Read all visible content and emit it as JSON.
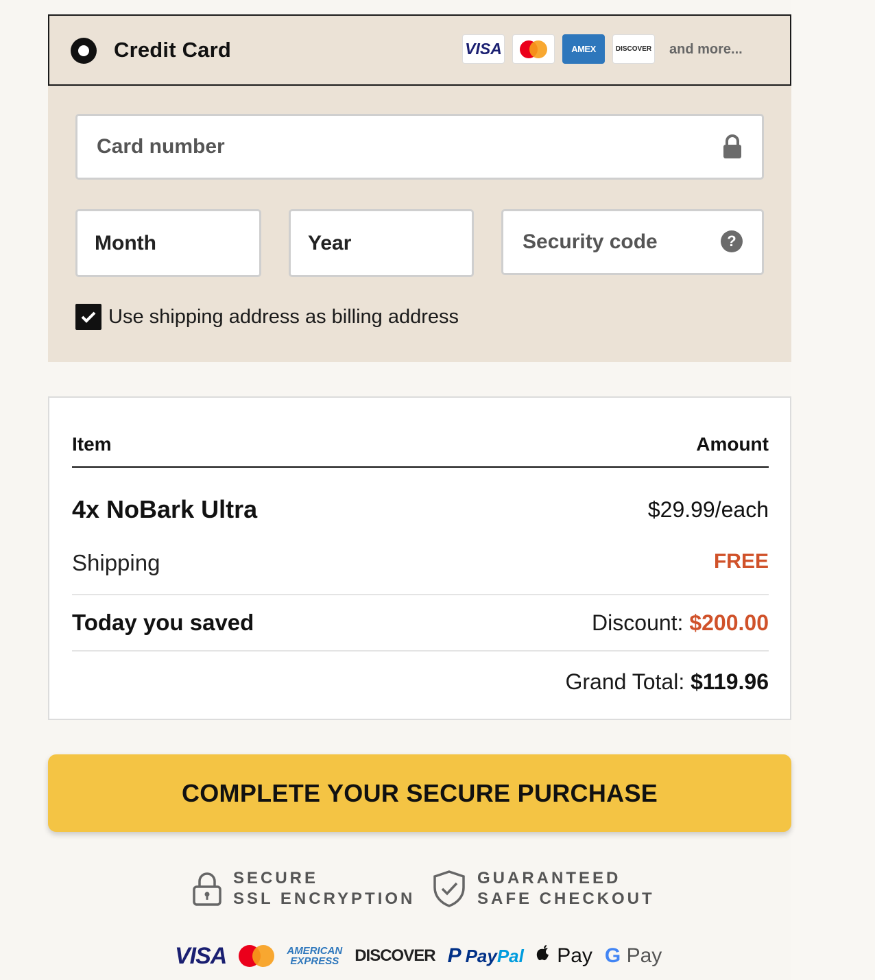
{
  "payment_method": {
    "title": "Credit Card",
    "selected": true,
    "card_logos": [
      "VISA",
      "mastercard",
      "AMEX",
      "DISCOVER"
    ],
    "and_more": "and more..."
  },
  "card_form": {
    "card_number_placeholder": "Card number",
    "month_placeholder": "Month",
    "year_placeholder": "Year",
    "security_code_placeholder": "Security code",
    "billing_checkbox_label": "Use shipping address as billing address",
    "billing_checkbox_checked": true
  },
  "summary": {
    "col_item": "Item",
    "col_amount": "Amount",
    "product_name": "4x NoBark Ultra",
    "product_price": "$29.99/each",
    "shipping_label": "Shipping",
    "shipping_value": "FREE",
    "saved_label": "Today you saved",
    "discount_label": "Discount:",
    "discount_value": "$200.00",
    "total_label": "Grand Total:",
    "total_value": "$119.96"
  },
  "cta": {
    "label": "COMPLETE YOUR SECURE PURCHASE"
  },
  "trust": {
    "ssl_line1": "SECURE",
    "ssl_line2": "SSL ENCRYPTION",
    "safe_line1": "GUARANTEED",
    "safe_line2": "SAFE CHECKOUT"
  },
  "footer_logos": {
    "visa": "VISA",
    "amex_line1": "AMERICAN",
    "amex_line2": "EXPRESS",
    "discover": "DISCOVER",
    "paypal_a": "Pay",
    "paypal_b": "Pal",
    "apple_pay": "Pay",
    "gpay_g": "G",
    "gpay": "Pay"
  },
  "colors": {
    "panel_bg": "#ebe2d6",
    "cta_bg": "#f4c444",
    "accent_orange": "#d0522a"
  }
}
